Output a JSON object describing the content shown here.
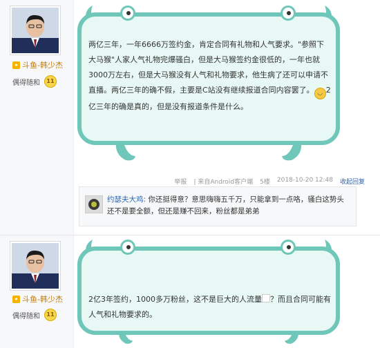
{
  "post1": {
    "user": {
      "name": "斗鱼-韩少杰",
      "meta_label": "偶得随和",
      "level": "11"
    },
    "content_part1": "两亿三年，一年6666万签约金，肯定合同有礼物和人气要求。\"参照下大马猴\"人家人气礼物完爆骚白，但是大马猴签约金很低的，一年也就3000万左右，但是大马猴没有人气和礼物要求，他生病了还可以申请不直播。两亿三年的确不假，主要是C站没有继续报道合同内容罢了。",
    "content_part2": "2亿三年的确是真的，但是没有报道条件是什么。",
    "footer": {
      "report": "举报",
      "source": "| 来自Android客户端",
      "floor": "5楼",
      "datetime": "2018-10-20 12:48",
      "collapse_reply": "收起回复"
    },
    "reply": {
      "user": "约瑟夫大鸡:",
      "text": " 你还挺得意？意思嗨嗨五千万，只能拿到一点咯，骚白这势头还不是要全额，但还是赚不回来，粉丝都是弟弟"
    }
  },
  "post2": {
    "user": {
      "name": "斗鱼-韩少杰",
      "meta_label": "偶得随和",
      "level": "11"
    },
    "content_part1": "2亿3年签约，1000多万粉丝，这不是巨大的人流量",
    "content_part2": "？而且合同可能有人气和礼物要求的。"
  },
  "colors": {
    "bubble_fill": "#e7f8f5",
    "bubble_border": "#6ec7b8",
    "link": "#2d64b3",
    "username": "#c97a00"
  }
}
